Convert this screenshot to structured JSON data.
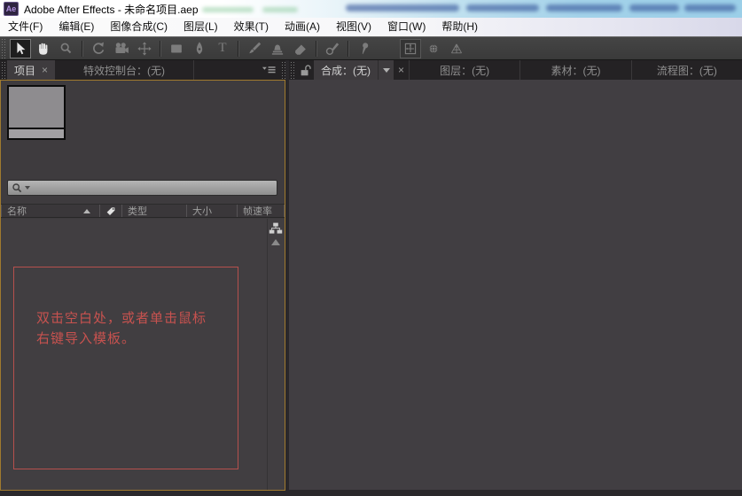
{
  "window": {
    "app_icon_text": "Ae",
    "title": "Adobe After Effects - 未命名项目.aep"
  },
  "menu": {
    "items": [
      {
        "label": "文件(F)"
      },
      {
        "label": "编辑(E)"
      },
      {
        "label": "图像合成(C)"
      },
      {
        "label": "图层(L)"
      },
      {
        "label": "效果(T)"
      },
      {
        "label": "动画(A)"
      },
      {
        "label": "视图(V)"
      },
      {
        "label": "窗口(W)"
      },
      {
        "label": "帮助(H)"
      }
    ]
  },
  "toolbar": {
    "active_tool": "selection",
    "tools": [
      "selection",
      "hand",
      "zoom",
      "rotation",
      "camera",
      "pan-behind",
      "rectangle-mask",
      "pen",
      "type",
      "brush",
      "clone-stamp",
      "eraser",
      "roto-brush",
      "puppet-pin",
      "local-axis-mode",
      "world-axis-mode",
      "view-axis-mode"
    ],
    "type_tool_glyph": "T"
  },
  "left_panel": {
    "tabs": [
      {
        "label": "项目",
        "active": true,
        "close_glyph": "×"
      },
      {
        "label": "特效控制台：(无)",
        "active": false
      }
    ],
    "project": {
      "columns": {
        "name": "名称",
        "type": "类型",
        "size": "大小",
        "frame_rate": "帧速率"
      },
      "search_value": "",
      "hint_line1": "双击空白处，或者单击鼠标",
      "hint_line2": "右键导入模板。"
    }
  },
  "right_panel": {
    "tabs": [
      {
        "label": "合成：(无)",
        "active": true,
        "close_glyph": "×"
      },
      {
        "label": "图层：(无)",
        "active": false
      },
      {
        "label": "素材：(无)",
        "active": false
      },
      {
        "label": "流程图：(无)",
        "active": false
      }
    ]
  },
  "colors": {
    "active_panel_border": "#a07a2e",
    "hint_red": "#c7524f",
    "titlebar_blue": "#9bcfe8",
    "panel_bg": "#3e3b3e",
    "tabbar_bg": "#242224"
  }
}
